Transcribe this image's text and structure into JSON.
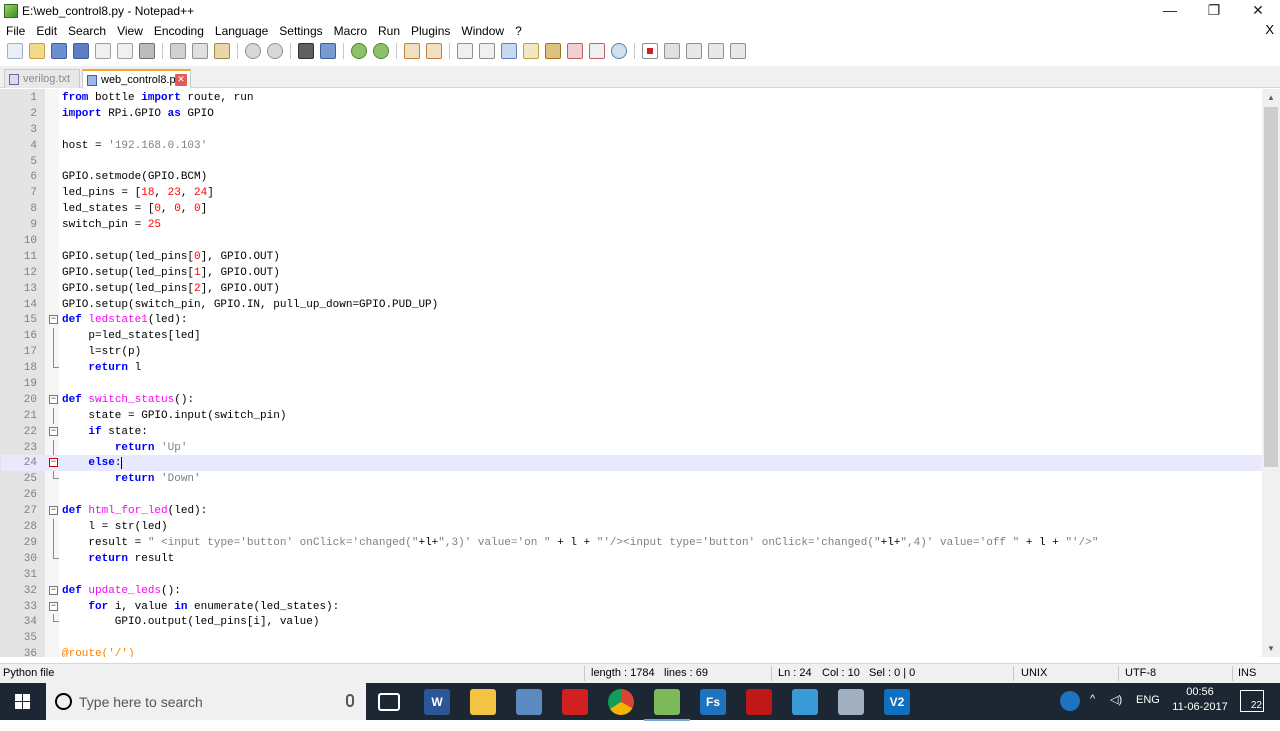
{
  "window": {
    "title": "E:\\web_control8.py - Notepad++",
    "minimize": "—",
    "restore": "❐",
    "close": "✕"
  },
  "menu": {
    "items": [
      "File",
      "Edit",
      "Search",
      "View",
      "Encoding",
      "Language",
      "Settings",
      "Macro",
      "Run",
      "Plugins",
      "Window",
      "?"
    ],
    "close_doc": "X"
  },
  "tabs": [
    {
      "label": "verilog.txt",
      "active": false
    },
    {
      "label": "web_control8.py",
      "active": true
    }
  ],
  "code": {
    "lines": [
      {
        "n": "1",
        "html": "<span class=\"kw\">from</span> bottle <span class=\"kw\">import</span> route, run"
      },
      {
        "n": "2",
        "html": "<span class=\"kw\">import</span> RPi.GPIO <span class=\"kw\">as</span> GPIO"
      },
      {
        "n": "3",
        "html": ""
      },
      {
        "n": "4",
        "html": "host = <span class=\"str\">'192.168.0.103'</span>"
      },
      {
        "n": "5",
        "html": ""
      },
      {
        "n": "6",
        "html": "GPIO.setmode(GPIO.BCM)"
      },
      {
        "n": "7",
        "html": "led_pins = [<span class=\"num\">18</span>, <span class=\"num\">23</span>, <span class=\"num\">24</span>]"
      },
      {
        "n": "8",
        "html": "led_states = [<span class=\"num\">0</span>, <span class=\"num\">0</span>, <span class=\"num\">0</span>]"
      },
      {
        "n": "9",
        "html": "switch_pin = <span class=\"num\">25</span>"
      },
      {
        "n": "10",
        "html": ""
      },
      {
        "n": "11",
        "html": "GPIO.setup(led_pins[<span class=\"num\">0</span>], GPIO.OUT)"
      },
      {
        "n": "12",
        "html": "GPIO.setup(led_pins[<span class=\"num\">1</span>], GPIO.OUT)"
      },
      {
        "n": "13",
        "html": "GPIO.setup(led_pins[<span class=\"num\">2</span>], GPIO.OUT)"
      },
      {
        "n": "14",
        "html": "GPIO.setup(switch_pin, GPIO.IN, pull_up_down=GPIO.PUD_UP)"
      },
      {
        "n": "15",
        "html": "<span class=\"kw\">def</span> <span class=\"fn\">ledstate1</span>(led):",
        "fold": "box"
      },
      {
        "n": "16",
        "html": "    p=led_states[led]",
        "fold": "line"
      },
      {
        "n": "17",
        "html": "    l=str(p)",
        "fold": "line"
      },
      {
        "n": "18",
        "html": "    <span class=\"kw\">return</span> l",
        "fold": "end"
      },
      {
        "n": "19",
        "html": ""
      },
      {
        "n": "20",
        "html": "<span class=\"kw\">def</span> <span class=\"fn\">switch_status</span>():",
        "fold": "box"
      },
      {
        "n": "21",
        "html": "    state = GPIO.input(switch_pin)",
        "fold": "line"
      },
      {
        "n": "22",
        "html": "    <span class=\"kw\">if</span> state:",
        "fold": "box"
      },
      {
        "n": "23",
        "html": "        <span class=\"kw\">return</span> <span class=\"str\">'Up'</span>",
        "fold": "line"
      },
      {
        "n": "24",
        "html": "    <span class=\"kw\">else</span>:<span class=\"caret\"></span>",
        "fold": "boxred",
        "current": true
      },
      {
        "n": "25",
        "html": "        <span class=\"kw\">return</span> <span class=\"str\">'Down'</span>",
        "fold": "end"
      },
      {
        "n": "26",
        "html": ""
      },
      {
        "n": "27",
        "html": "<span class=\"kw\">def</span> <span class=\"fn\">html_for_led</span>(led):",
        "fold": "box"
      },
      {
        "n": "28",
        "html": "    l = str(led)",
        "fold": "line"
      },
      {
        "n": "29",
        "html": "    result = <span class=\"str\">\" &lt;input type='button' onClick='changed(\"</span>+l+<span class=\"str\">\",3)' value='on \"</span> + l + <span class=\"str\">\"'/&gt;&lt;input type='button' onClick='changed(\"</span>+l+<span class=\"str\">\",4)' value='off \"</span> + l + <span class=\"str\">\"'/&gt;\"</span>",
        "fold": "line"
      },
      {
        "n": "30",
        "html": "    <span class=\"kw\">return</span> result",
        "fold": "end"
      },
      {
        "n": "31",
        "html": ""
      },
      {
        "n": "32",
        "html": "<span class=\"kw\">def</span> <span class=\"fn\">update_leds</span>():",
        "fold": "box"
      },
      {
        "n": "33",
        "html": "    <span class=\"kw\">for</span> i, value <span class=\"kw\">in</span> enumerate(led_states):",
        "fold": "box"
      },
      {
        "n": "34",
        "html": "        GPIO.output(led_pins[i], value)",
        "fold": "end"
      },
      {
        "n": "35",
        "html": ""
      },
      {
        "n": "36",
        "html": "<span class=\"deco\">@route('/')</span>"
      }
    ]
  },
  "status": {
    "file_type": "Python file",
    "length": "length : 1784",
    "lines": "lines : 69",
    "ln": "Ln : 24",
    "col": "Col : 10",
    "sel": "Sel : 0 | 0",
    "eol": "UNIX",
    "encoding": "UTF-8",
    "mode": "INS"
  },
  "taskbar": {
    "search_placeholder": "Type here to search",
    "language": "ENG",
    "time": "00:56",
    "date": "11-06-2017",
    "notifications": "22",
    "app_labels": {
      "fs": "Fs",
      "vs": "V2"
    }
  },
  "colors": {
    "keyword": "#0000ff",
    "function": "#ff00ff",
    "string": "#808080",
    "number": "#ff0000",
    "decorator": "#ff8000",
    "active_tab_accent": "#f6a531",
    "taskbar": "#1c2733"
  }
}
